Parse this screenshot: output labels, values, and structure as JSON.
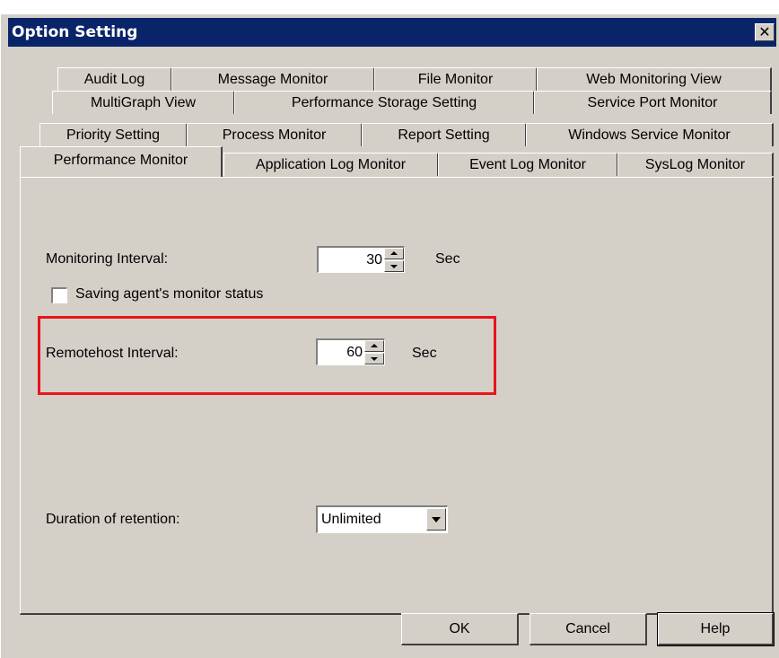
{
  "window": {
    "title": "Option Setting",
    "close_label": "✕"
  },
  "tabs": {
    "row1": [
      "Audit Log",
      "Message Monitor",
      "File Monitor",
      "Web Monitoring View"
    ],
    "row2": [
      "MultiGraph View",
      "Performance Storage Setting",
      "Service Port Monitor"
    ],
    "row3": [
      "Priority Setting",
      "Process Monitor",
      "Report Setting",
      "Windows Service Monitor"
    ],
    "row4": [
      "Performance Monitor",
      "Application Log Monitor",
      "Event Log Monitor",
      "SysLog Monitor"
    ],
    "active": "Performance Monitor"
  },
  "form": {
    "monitoring_interval_label": "Monitoring Interval:",
    "monitoring_interval_value": "30",
    "monitoring_interval_unit": "Sec",
    "saving_status_label": "Saving agent's monitor status",
    "saving_status_checked": false,
    "remotehost_interval_label": "Remotehost Interval:",
    "remotehost_interval_value": "60",
    "remotehost_interval_unit": "Sec",
    "retention_label": "Duration of retention:",
    "retention_value": "Unlimited"
  },
  "buttons": {
    "ok": "OK",
    "cancel": "Cancel",
    "help": "Help"
  },
  "colors": {
    "titlebar": "#0a246a",
    "dialog_bg": "#d4d0c8",
    "highlight": "#e8141b"
  }
}
